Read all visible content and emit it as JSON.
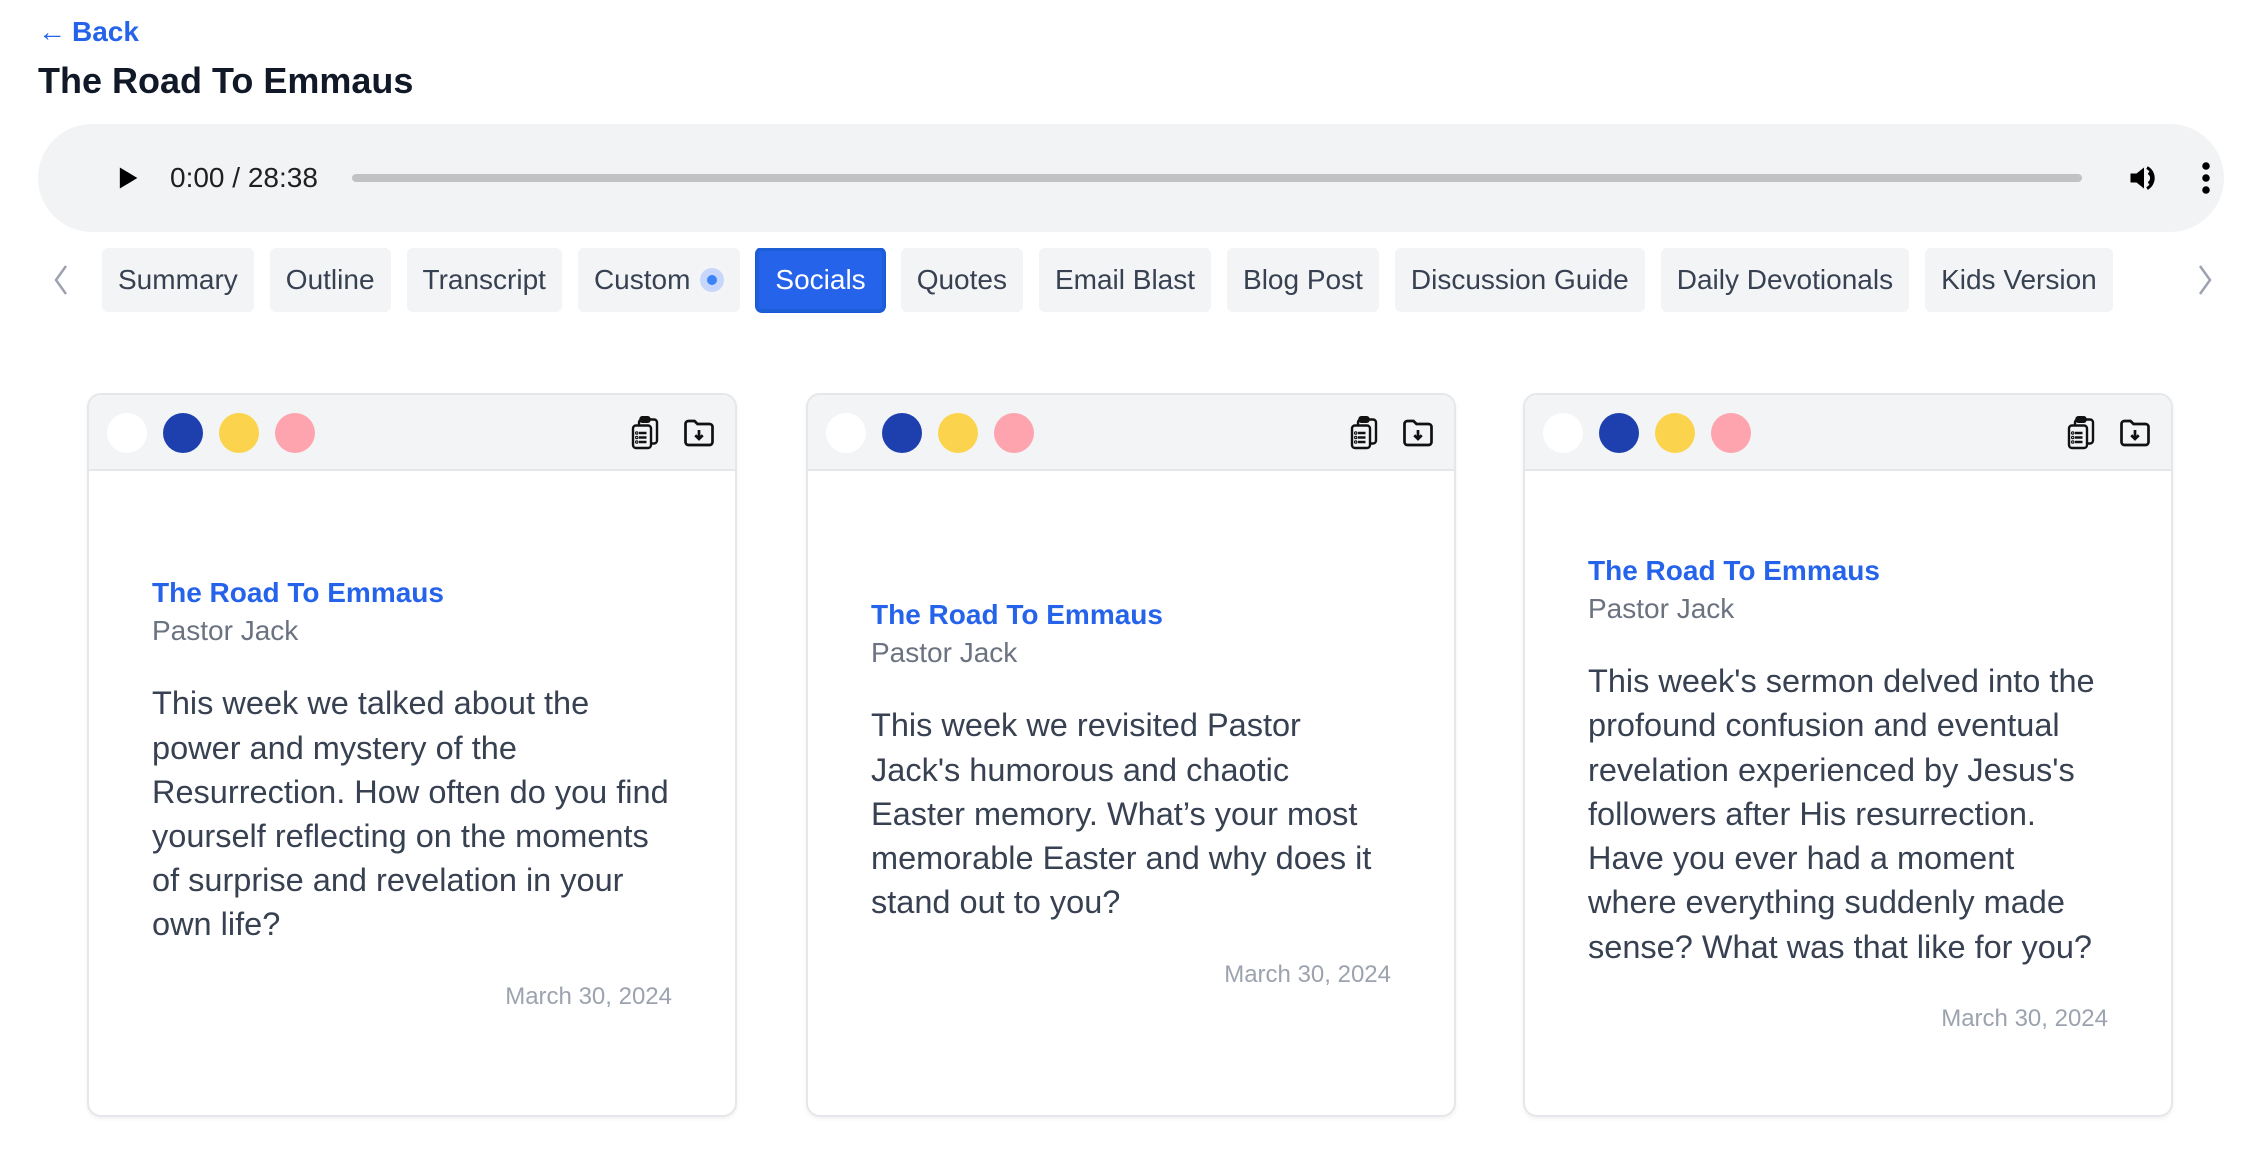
{
  "nav": {
    "back_label": "Back"
  },
  "page": {
    "title": "The Road To Emmaus"
  },
  "player": {
    "time": "0:00 / 28:38",
    "progress_fraction": 0
  },
  "tabs": [
    {
      "label": "Summary",
      "active": false,
      "badge": false
    },
    {
      "label": "Outline",
      "active": false,
      "badge": false
    },
    {
      "label": "Transcript",
      "active": false,
      "badge": false
    },
    {
      "label": "Custom",
      "active": false,
      "badge": true
    },
    {
      "label": "Socials",
      "active": true,
      "badge": false
    },
    {
      "label": "Quotes",
      "active": false,
      "badge": false
    },
    {
      "label": "Email Blast",
      "active": false,
      "badge": false
    },
    {
      "label": "Blog Post",
      "active": false,
      "badge": false
    },
    {
      "label": "Discussion Guide",
      "active": false,
      "badge": false
    },
    {
      "label": "Daily Devotionals",
      "active": false,
      "badge": false
    },
    {
      "label": "Kids Version",
      "active": false,
      "badge": false
    }
  ],
  "swatch_colors": [
    "#ffffff",
    "#1e40af",
    "#fcd34d",
    "#fda4af"
  ],
  "colors": {
    "accent": "#2563eb"
  },
  "cards": [
    {
      "title": "The Road To Emmaus",
      "author": "Pastor Jack",
      "text": "This week we talked about the power and mystery of the Resurrection. How often do you find yourself reflecting on the moments of surprise and revelation in your own life?",
      "date": "March 30, 2024"
    },
    {
      "title": "The Road To Emmaus",
      "author": "Pastor Jack",
      "text": "This week we revisited Pastor Jack's humorous and chaotic Easter memory. What’s your most memorable Easter and why does it stand out to you?",
      "date": "March 30, 2024"
    },
    {
      "title": "The Road To Emmaus",
      "author": "Pastor Jack",
      "text": "This week's sermon delved into the profound confusion and eventual revelation experienced by Jesus's followers after His resurrection. Have you ever had a moment where everything suddenly made sense? What was that like for you?",
      "date": "March 30, 2024"
    }
  ]
}
